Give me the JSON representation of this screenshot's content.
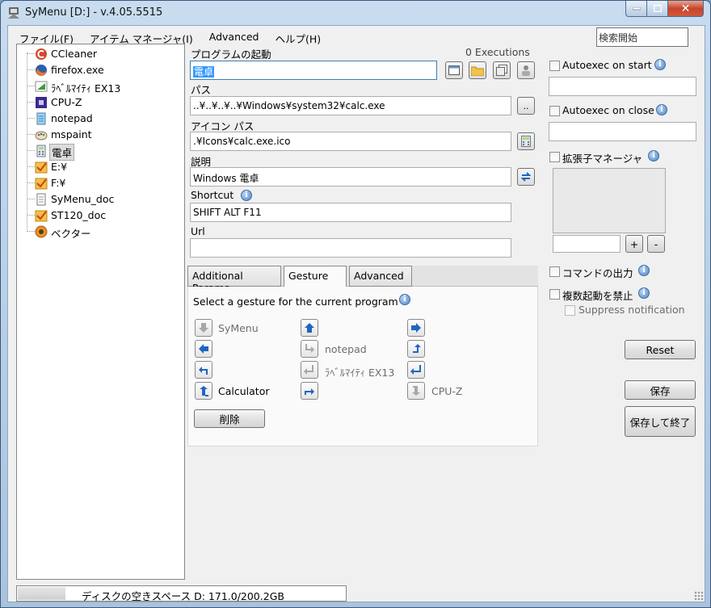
{
  "window": {
    "title": "SyMenu [D:] - v.4.05.5515"
  },
  "menu": [
    "ファイル(F)",
    "アイテム マネージャ(I)",
    "Advanced",
    "ヘルプ(H)"
  ],
  "search": {
    "value": "検索開始"
  },
  "tree": [
    {
      "label": "CCleaner",
      "icon": "ccleaner-icon"
    },
    {
      "label": "firefox.exe",
      "icon": "firefox-icon"
    },
    {
      "label": "ﾗﾍﾞﾙﾏｲﾃｨ EX13",
      "icon": "label-icon"
    },
    {
      "label": "CPU-Z",
      "icon": "cpuz-icon"
    },
    {
      "label": "notepad",
      "icon": "notepad-icon"
    },
    {
      "label": "mspaint",
      "icon": "paint-icon"
    },
    {
      "label": "電卓",
      "icon": "calculator-icon",
      "selected": true
    },
    {
      "label": "E:¥",
      "icon": "folder-check-icon"
    },
    {
      "label": "F:¥",
      "icon": "folder-check-icon"
    },
    {
      "label": "SyMenu_doc",
      "icon": "document-icon"
    },
    {
      "label": "ST120_doc",
      "icon": "folder-check-icon"
    },
    {
      "label": "ベクター",
      "icon": "vector-icon"
    }
  ],
  "form": {
    "program_label": "プログラムの起動",
    "executions": "0 Executions",
    "program_value": "電卓",
    "path_label": "パス",
    "path_value": "..¥..¥..¥..¥Windows¥system32¥calc.exe",
    "browse_label": "..",
    "icon_path_label": "アイコン パス",
    "icon_path_value": ".¥Icons¥calc.exe.ico",
    "description_label": "説明",
    "description_value": "Windows 電卓",
    "shortcut_label": "Shortcut",
    "shortcut_value": "SHIFT ALT F11",
    "url_label": "Url",
    "url_value": ""
  },
  "tabs": [
    {
      "label": "Additional Params"
    },
    {
      "label": "Gesture",
      "active": true
    },
    {
      "label": "Advanced"
    }
  ],
  "gesture": {
    "instruction": "Select a gesture for the current program",
    "items": [
      {
        "label": "SyMenu",
        "dim": true
      },
      {
        "label": ""
      },
      {
        "label": ""
      },
      {
        "label": ""
      },
      {
        "label": "notepad",
        "dim": true
      },
      {
        "label": ""
      },
      {
        "label": ""
      },
      {
        "label": "ﾗﾍﾞﾙﾏｲﾃｨ EX13",
        "dim": true
      },
      {
        "label": ""
      },
      {
        "label": "Calculator"
      },
      {
        "label": ""
      },
      {
        "label": "CPU-Z",
        "dim": true
      }
    ],
    "delete_label": "削除"
  },
  "options": {
    "autoexec_start": "Autoexec on start",
    "autoexec_close": "Autoexec on close",
    "extension_manager": "拡張子マネージャ",
    "plus": "+",
    "minus": "-",
    "command_output": "コマンドの出力",
    "prevent_multiple": "複数起動を禁止",
    "suppress_notification": "Suppress notification"
  },
  "buttons": {
    "reset": "Reset",
    "save": "保存",
    "save_exit": "保存して終了"
  },
  "status": {
    "disk_text": "ディスクの空きスペース D:  171.0/200.2GB",
    "usage_fraction": 0.146
  }
}
